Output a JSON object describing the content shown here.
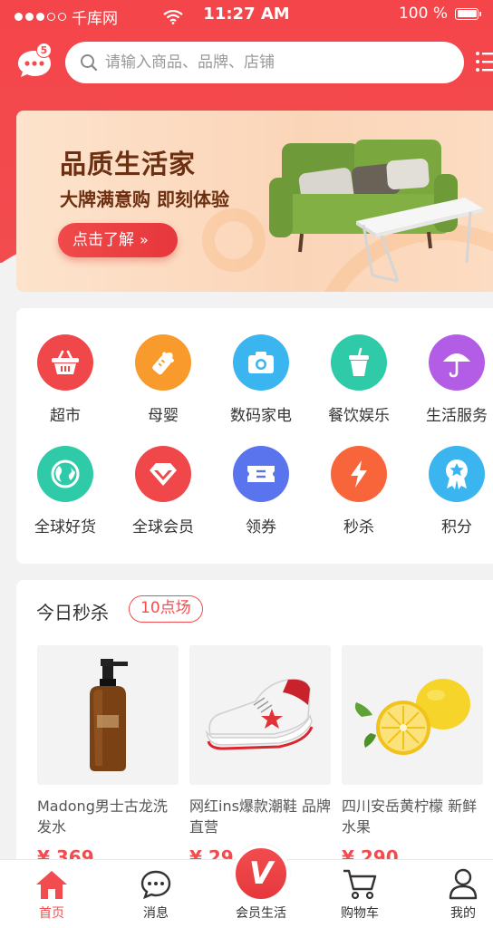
{
  "status_bar": {
    "carrier": "千库网",
    "time": "11:27 AM",
    "battery": "100 %"
  },
  "header": {
    "message_badge": "5",
    "search_placeholder": "请输入商品、品牌、店铺"
  },
  "banner": {
    "title": "品质生活家",
    "subtitle": "大牌满意购 即刻体验",
    "button": "点击了解"
  },
  "categories": [
    {
      "label": "超市",
      "icon": "basket-icon",
      "color": "#f0474b"
    },
    {
      "label": "母婴",
      "icon": "baby-bottle-icon",
      "color": "#f99a2d"
    },
    {
      "label": "数码家电",
      "icon": "camera-icon",
      "color": "#3bb5f0"
    },
    {
      "label": "餐饮娱乐",
      "icon": "drink-cup-icon",
      "color": "#2fcaa8"
    },
    {
      "label": "生活服务",
      "icon": "umbrella-icon",
      "color": "#b35de6"
    },
    {
      "label": "全球好货",
      "icon": "globe-icon",
      "color": "#2fcaa8"
    },
    {
      "label": "全球会员",
      "icon": "diamond-icon",
      "color": "#f0474b"
    },
    {
      "label": "领券",
      "icon": "ticket-icon",
      "color": "#5a74ee"
    },
    {
      "label": "秒杀",
      "icon": "lightning-icon",
      "color": "#f9653a"
    },
    {
      "label": "积分",
      "icon": "medal-icon",
      "color": "#3bb5f0"
    }
  ],
  "flash_sale": {
    "title": "今日秒杀",
    "session": "10点场",
    "products": [
      {
        "name": "Madong男士古龙洗发水",
        "price": "¥ 369",
        "icon": "shampoo-bottle-icon"
      },
      {
        "name": "网红ins爆款潮鞋 品牌直营",
        "price": "¥ 29",
        "icon": "sneaker-icon"
      },
      {
        "name": "四川安岳黄柠檬 新鲜水果",
        "price": "¥ 290",
        "icon": "lemon-icon"
      }
    ]
  },
  "tabbar": [
    {
      "label": "首页",
      "icon": "home-icon",
      "active": true
    },
    {
      "label": "消息",
      "icon": "chat-bubble-icon",
      "active": false
    },
    {
      "label": "会员生活",
      "icon": "vip-icon",
      "active": false
    },
    {
      "label": "购物车",
      "icon": "cart-icon",
      "active": false
    },
    {
      "label": "我的",
      "icon": "user-icon",
      "active": false
    }
  ],
  "colors": {
    "brand": "#f24c4f",
    "banner_text": "#6d2f12"
  }
}
